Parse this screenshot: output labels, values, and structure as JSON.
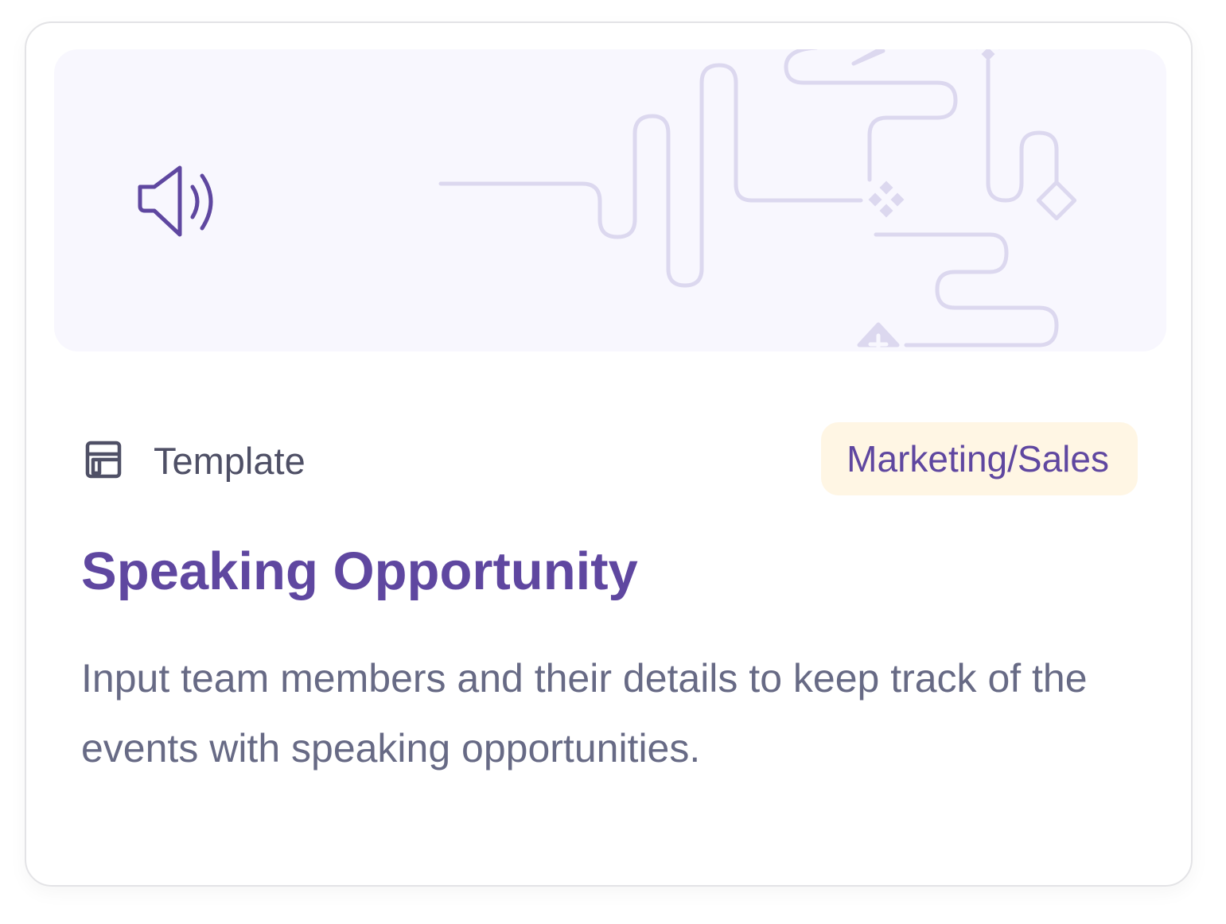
{
  "card": {
    "type_label": "Template",
    "type_icon": "template-layout-icon",
    "category_badge": "Marketing/Sales",
    "title": "Speaking Opportunity",
    "description": "Input team members and their details to keep track of the events with speaking opportunities.",
    "banner_icon": "speaker-icon"
  },
  "colors": {
    "accent": "#5f47a0",
    "banner_bg": "#f8f7fe",
    "badge_bg": "#fff6e4",
    "decoration_line": "#dcd8ef",
    "text_muted": "#676a85"
  }
}
